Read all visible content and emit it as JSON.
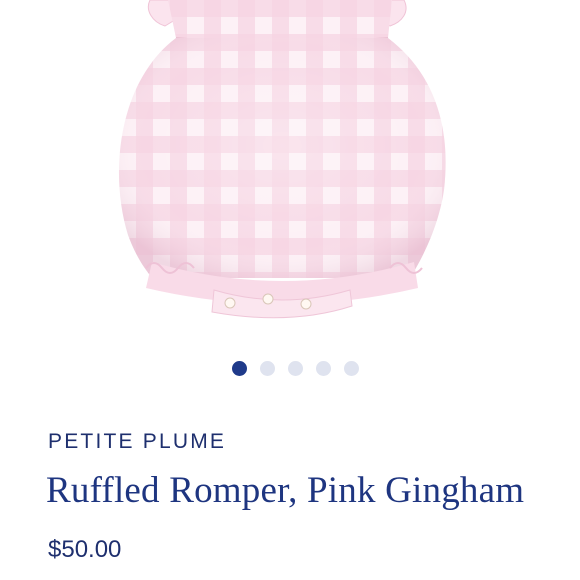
{
  "product": {
    "image_alt": "romper-photo",
    "brand": "PETITE PLUME",
    "title": "Ruffled Romper, Pink Gingham",
    "price": "$50.00"
  },
  "carousel": {
    "total": 5,
    "active_index": 0
  },
  "colors": {
    "accent": "#1e3580",
    "dot_active": "#1f3a8a",
    "dot_inactive": "#dfe3ef",
    "fabric_pink": "#f7d4e4"
  }
}
